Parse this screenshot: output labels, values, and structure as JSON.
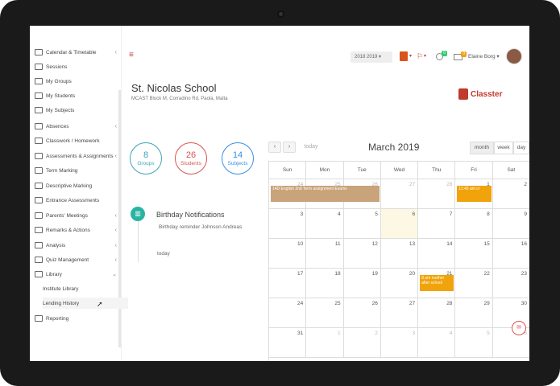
{
  "sidebar": {
    "items": [
      {
        "label": "Calendar & Timetable",
        "chevron": "‹"
      },
      {
        "label": "Sessions",
        "chevron": ""
      },
      {
        "label": "My Groups",
        "chevron": ""
      },
      {
        "label": "My Students",
        "chevron": ""
      },
      {
        "label": "My Subjects",
        "chevron": ""
      },
      {
        "label": "Absences",
        "chevron": "‹"
      },
      {
        "label": "Classwork / Homework",
        "chevron": ""
      },
      {
        "label": "Assessments & Assignments",
        "chevron": "‹"
      },
      {
        "label": "Term Marking",
        "chevron": ""
      },
      {
        "label": "Descriptive Marking",
        "chevron": ""
      },
      {
        "label": "Entrance Assessments",
        "chevron": ""
      },
      {
        "label": "Parents' Meetings",
        "chevron": "‹"
      },
      {
        "label": "Remarks & Actions",
        "chevron": "‹"
      },
      {
        "label": "Analysis",
        "chevron": "‹"
      },
      {
        "label": "Quiz Management",
        "chevron": "‹"
      },
      {
        "label": "Library",
        "chevron": "⌄"
      },
      {
        "label": "Institute Library",
        "chevron": ""
      },
      {
        "label": "Lending History",
        "chevron": ""
      },
      {
        "label": "Reporting",
        "chevron": ""
      }
    ]
  },
  "topbar": {
    "hamburger": "≡",
    "year": "2018 2019 ▾",
    "flag_icon": "⚐",
    "flag_caret": "▾",
    "notif_count": "0",
    "msg_count": "0",
    "user_name": "Elaine Borg ▾",
    "office_caret": "▾"
  },
  "school": {
    "name": "St. Nicolas School",
    "address": "MCAST Block M, Corradino Rd, Paola, Malta",
    "brand": "Classter"
  },
  "stats": [
    {
      "value": "8",
      "label": "Groups"
    },
    {
      "value": "26",
      "label": "Students"
    },
    {
      "value": "14",
      "label": "Subjects"
    }
  ],
  "notification": {
    "icon": "▥",
    "title": "Birthday Notifications",
    "body": "Birthday reminder Johnson Andreas",
    "time": "today"
  },
  "calendar": {
    "prev": "‹",
    "next": "›",
    "today": "today",
    "title": "March 2019",
    "views": [
      "month",
      "week",
      "day"
    ],
    "weekdays": [
      "Sun",
      "Mon",
      "Tue",
      "Wed",
      "Thu",
      "Fri",
      "Sat"
    ],
    "weeks": [
      [
        {
          "d": "24",
          "o": true
        },
        {
          "d": "25",
          "o": true
        },
        {
          "d": "26",
          "o": true
        },
        {
          "d": "27",
          "o": true
        },
        {
          "d": "28",
          "o": true
        },
        {
          "d": "1",
          "o": false
        },
        {
          "d": "2",
          "o": false
        }
      ],
      [
        {
          "d": "3",
          "o": false
        },
        {
          "d": "4",
          "o": false
        },
        {
          "d": "5",
          "o": false
        },
        {
          "d": "6",
          "o": false
        },
        {
          "d": "7",
          "o": false
        },
        {
          "d": "8",
          "o": false
        },
        {
          "d": "9",
          "o": false
        }
      ],
      [
        {
          "d": "10",
          "o": false
        },
        {
          "d": "11",
          "o": false
        },
        {
          "d": "12",
          "o": false
        },
        {
          "d": "13",
          "o": false
        },
        {
          "d": "14",
          "o": false
        },
        {
          "d": "15",
          "o": false
        },
        {
          "d": "16",
          "o": false
        }
      ],
      [
        {
          "d": "17",
          "o": false
        },
        {
          "d": "18",
          "o": false
        },
        {
          "d": "19",
          "o": false
        },
        {
          "d": "20",
          "o": false
        },
        {
          "d": "21",
          "o": false
        },
        {
          "d": "22",
          "o": false
        },
        {
          "d": "23",
          "o": false
        }
      ],
      [
        {
          "d": "24",
          "o": false
        },
        {
          "d": "25",
          "o": false
        },
        {
          "d": "26",
          "o": false
        },
        {
          "d": "27",
          "o": false
        },
        {
          "d": "28",
          "o": false
        },
        {
          "d": "29",
          "o": false
        },
        {
          "d": "30",
          "o": false
        }
      ],
      [
        {
          "d": "31",
          "o": false
        },
        {
          "d": "1",
          "o": true
        },
        {
          "d": "2",
          "o": true
        },
        {
          "d": "3",
          "o": true
        },
        {
          "d": "4",
          "o": true
        },
        {
          "d": "5",
          "o": true
        },
        {
          "d": "6",
          "o": true
        }
      ]
    ],
    "today_date": "6",
    "events": [
      {
        "text": "14D English 2nd Term assignment Exams",
        "color": "tan"
      },
      {
        "text": "11:45 am cr",
        "color": "orange"
      },
      {
        "text": "8 am mother after school",
        "color": "orange"
      }
    ]
  },
  "chat_icon": "✉"
}
